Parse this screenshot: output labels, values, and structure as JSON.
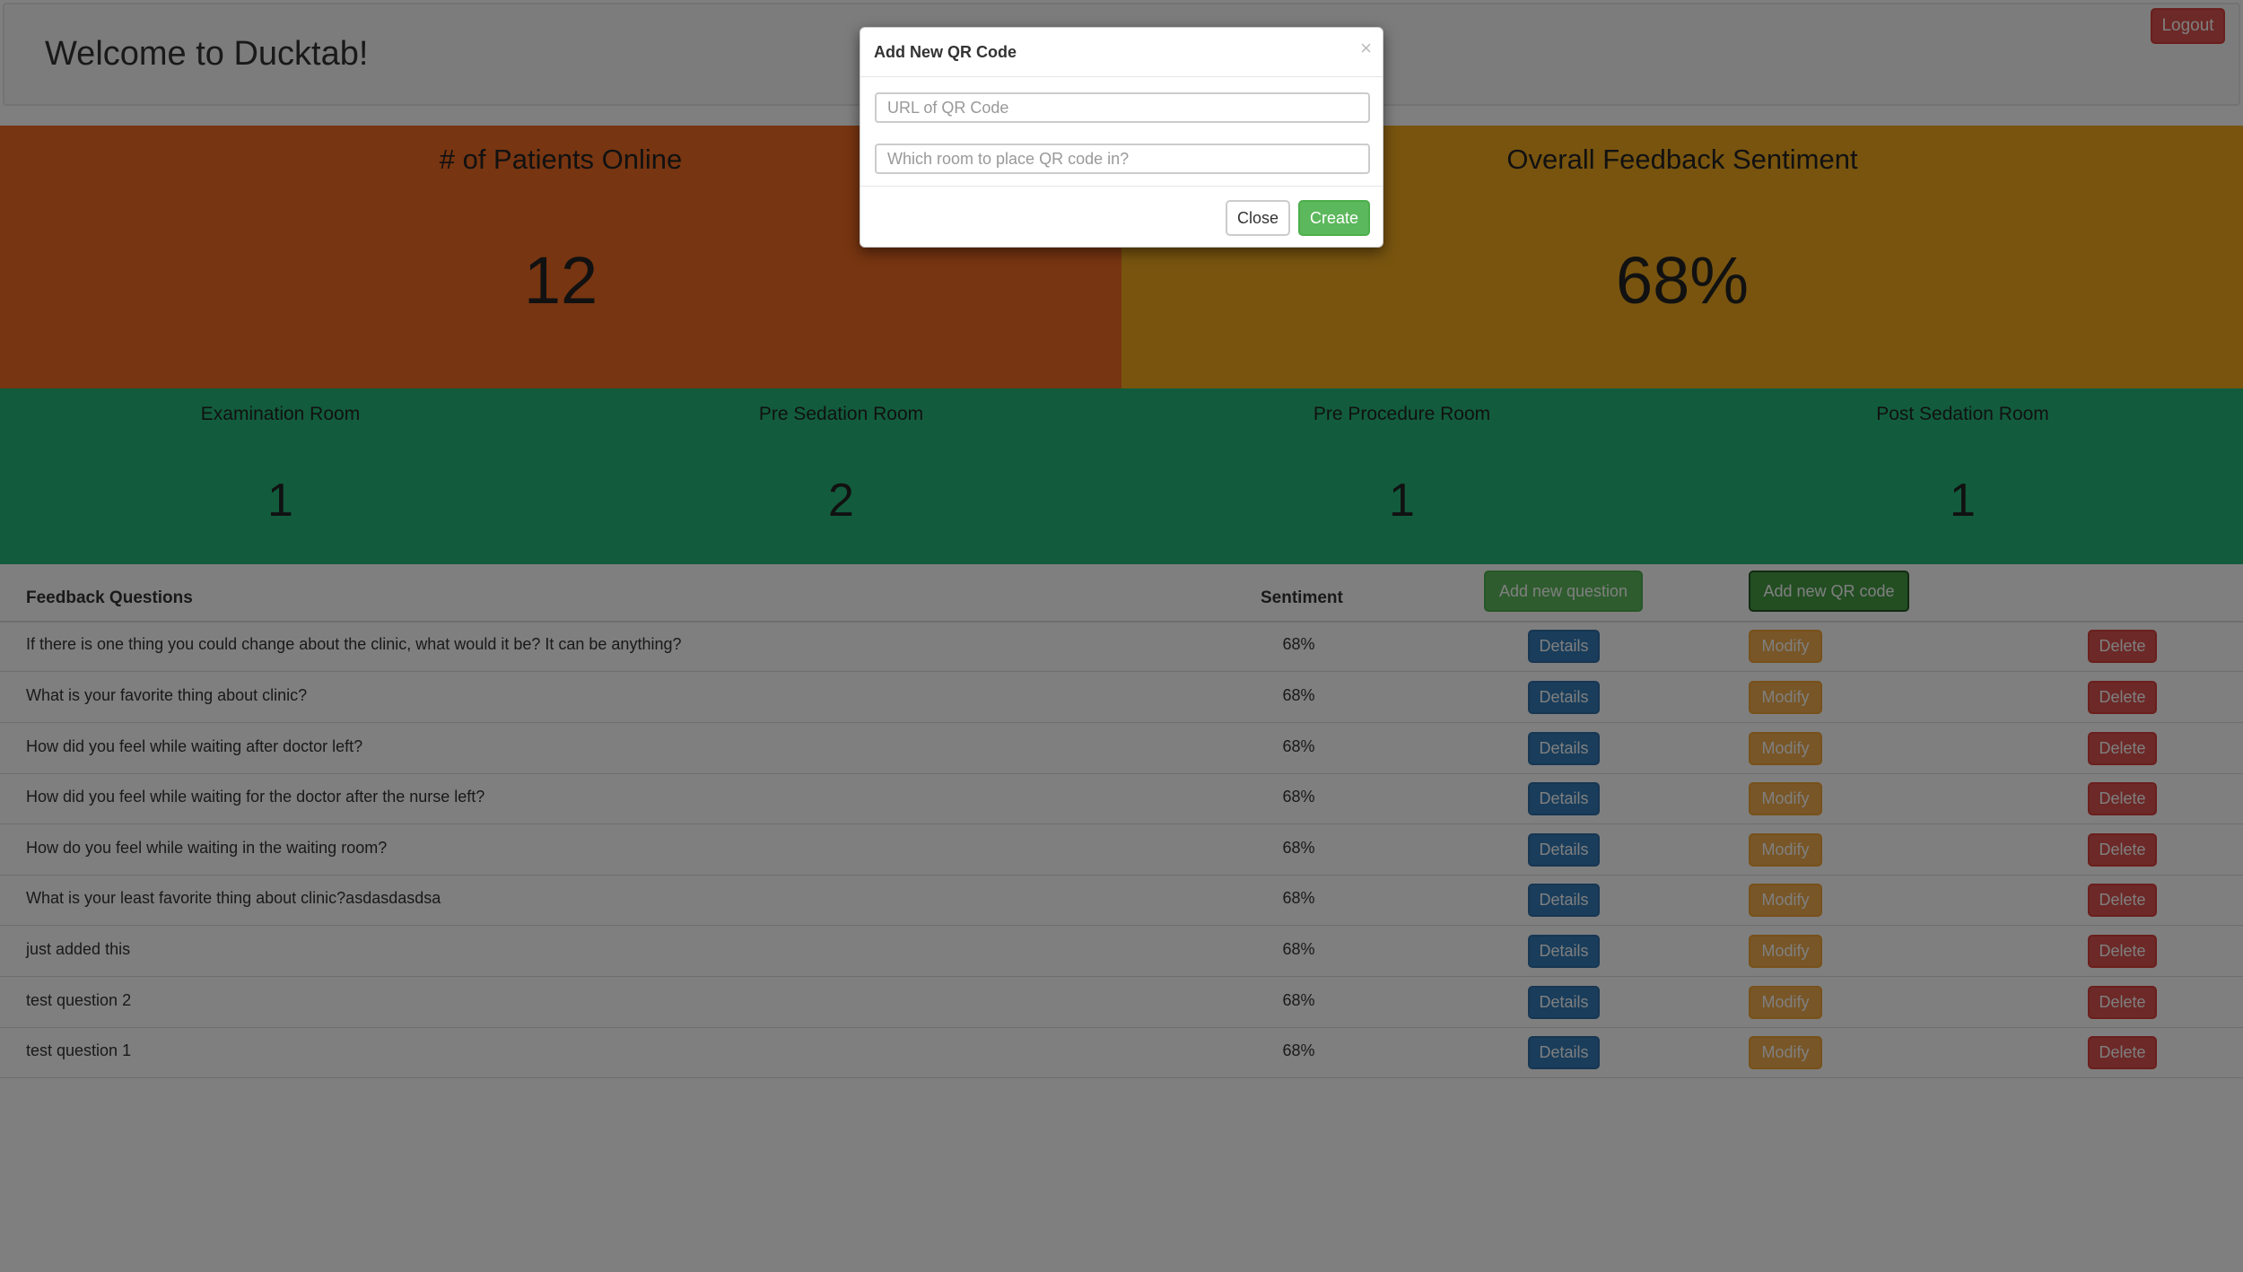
{
  "header": {
    "title": "Welcome to Ducktab!",
    "logout_label": "Logout"
  },
  "stats": {
    "patients": {
      "title": "# of Patients Online",
      "value": "12"
    },
    "sentiment": {
      "title": "Overall Feedback Sentiment",
      "value": "68%"
    }
  },
  "rooms": [
    {
      "name": "Examination Room",
      "count": "1"
    },
    {
      "name": "Pre Sedation Room",
      "count": "2"
    },
    {
      "name": "Pre Procedure Room",
      "count": "1"
    },
    {
      "name": "Post Sedation Room",
      "count": "1"
    }
  ],
  "table": {
    "header": {
      "questions": "Feedback Questions",
      "sentiment": "Sentiment",
      "add_question": "Add new question",
      "add_qr": "Add new QR code"
    },
    "actions": {
      "details": "Details",
      "modify": "Modify",
      "delete": "Delete"
    },
    "rows": [
      {
        "question": "If there is one thing you could change about the clinic, what would it be? It can be anything?",
        "sentiment": "68%"
      },
      {
        "question": "What is your favorite thing about clinic?",
        "sentiment": "68%"
      },
      {
        "question": "How did you feel while waiting after doctor left?",
        "sentiment": "68%"
      },
      {
        "question": "How did you feel while waiting for the doctor after the nurse left?",
        "sentiment": "68%"
      },
      {
        "question": "How do you feel while waiting in the waiting room?",
        "sentiment": "68%"
      },
      {
        "question": "What is your least favorite thing about clinic?asdasdasdsa",
        "sentiment": "68%"
      },
      {
        "question": "just added this",
        "sentiment": "68%"
      },
      {
        "question": "test question 2",
        "sentiment": "68%"
      },
      {
        "question": "test question 1",
        "sentiment": "68%"
      }
    ]
  },
  "modal": {
    "title": "Add New QR Code",
    "close_symbol": "×",
    "url_placeholder": "URL of QR Code",
    "url_value": "",
    "room_placeholder": "Which room to place QR code in?",
    "room_value": "",
    "close_label": "Close",
    "create_label": "Create"
  },
  "colors": {
    "patients_panel": "#ee6a22",
    "sentiment_panel": "#f1a91f",
    "rooms_panel": "#24b87a",
    "primary": "#337ab7",
    "warning": "#f0ad4e",
    "danger": "#d9534f",
    "success": "#5cb85c"
  }
}
